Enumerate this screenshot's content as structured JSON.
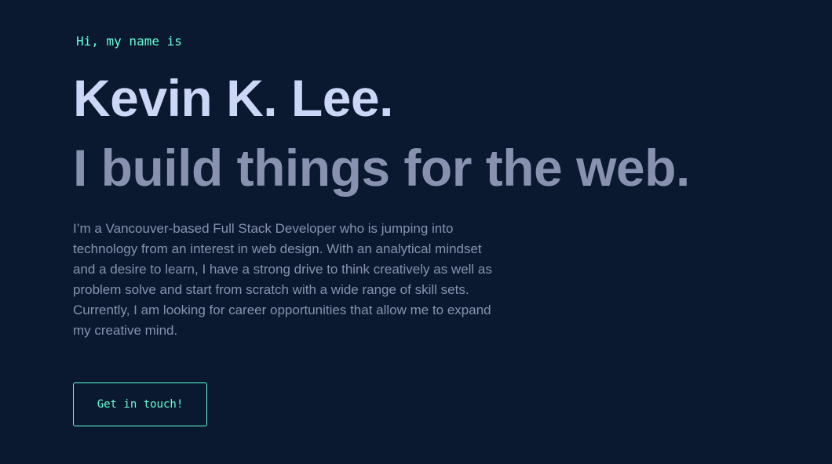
{
  "hero": {
    "greeting": "Hi, my name is",
    "name": "Kevin K. Lee.",
    "tagline": "I build things for the web.",
    "bio": "I’m a Vancouver-based Full Stack Developer who is jumping into technology from an interest in web design. With an analytical mindset and a desire to learn, I have a strong drive to think creatively as well as problem solve and start from scratch with a wide range of skill sets. Currently, I am looking for career opportunities that allow me to expand my creative mind.",
    "cta_label": "Get in touch!"
  },
  "colors": {
    "background": "#0a192f",
    "accent": "#64ffda",
    "heading": "#ccd6f6",
    "body_text": "#8892b0"
  }
}
